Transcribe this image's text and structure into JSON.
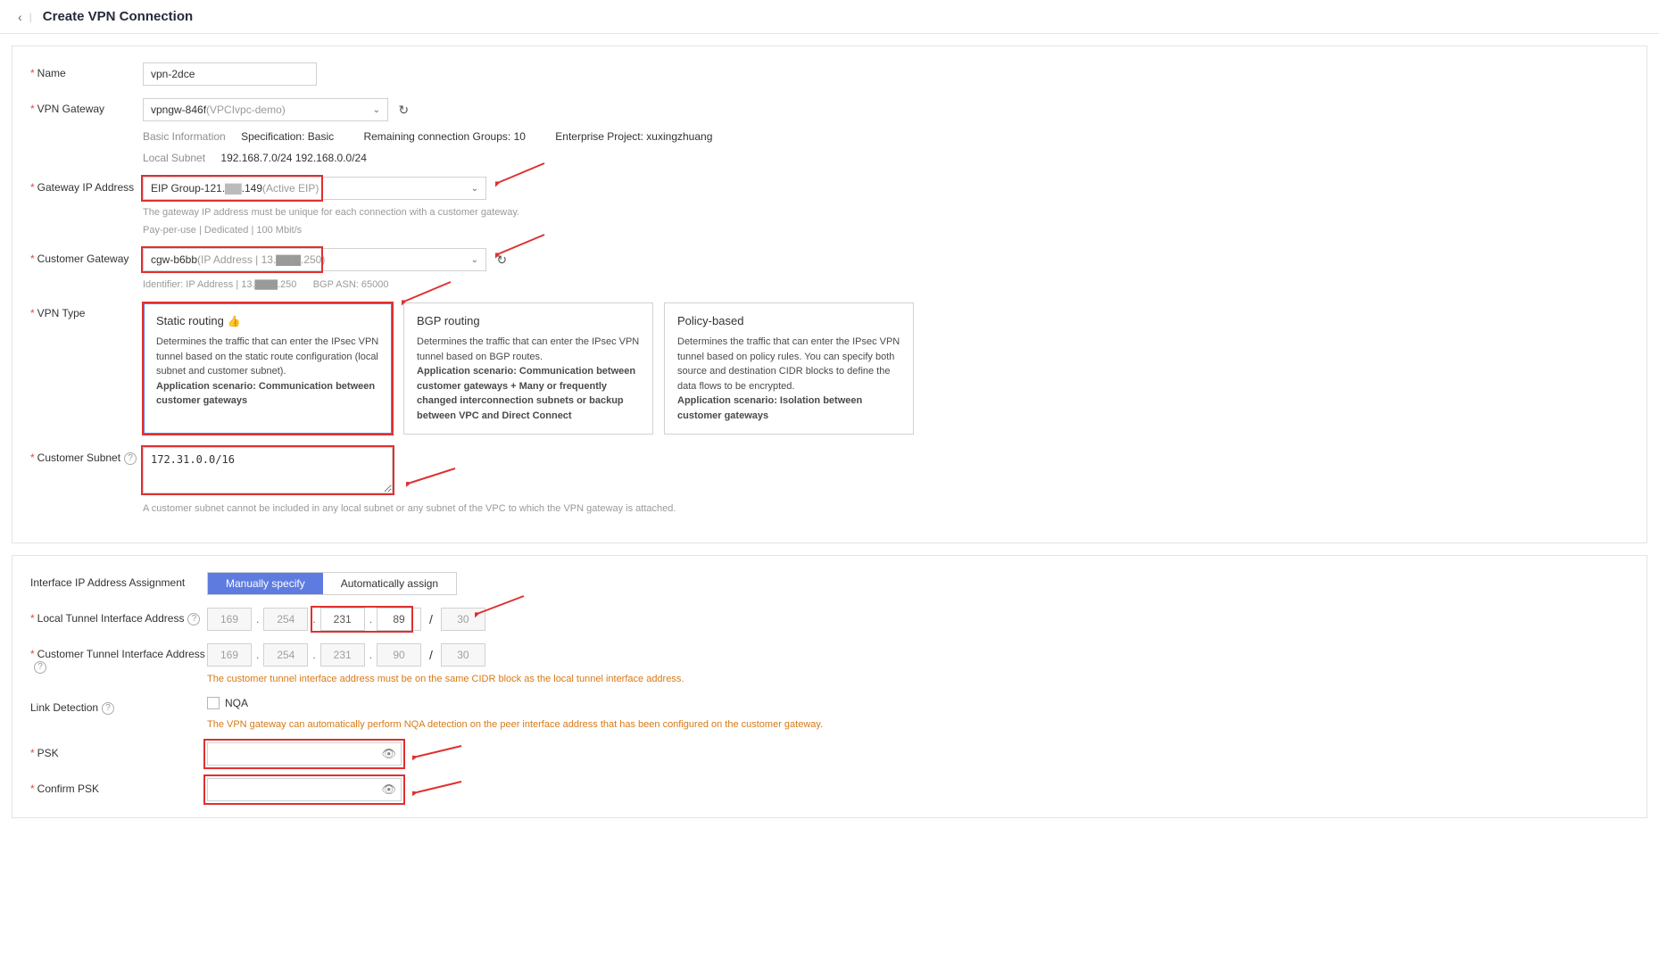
{
  "header": {
    "title": "Create VPN Connection"
  },
  "labels": {
    "name": "Name",
    "vpn_gateway": "VPN Gateway",
    "gateway_ip": "Gateway IP Address",
    "customer_gateway": "Customer Gateway",
    "vpn_type": "VPN Type",
    "customer_subnet": "Customer Subnet",
    "interface_assignment": "Interface IP Address Assignment",
    "local_tunnel": "Local Tunnel Interface Address",
    "customer_tunnel": "Customer Tunnel Interface Address",
    "link_detection": "Link Detection",
    "psk": "PSK",
    "confirm_psk": "Confirm PSK"
  },
  "name": "vpn-2dce",
  "vpn_gateway": {
    "selected": "vpngw-846f",
    "selected_suffix": "(VPCIvpc-demo)",
    "basic_info_label": "Basic Information",
    "spec": "Specification: Basic",
    "remaining": "Remaining connection Groups: 10",
    "enterprise_project": "Enterprise Project: xuxingzhuang",
    "local_subnet_label": "Local Subnet",
    "local_subnet": "192.168.7.0/24 192.168.0.0/24"
  },
  "gateway_ip": {
    "prefix": "EIP Group-121.",
    "masked": "▇▇",
    "suffix": ".149",
    "status": "(Active EIP)",
    "hint": "The gateway IP address must be unique for each connection with a customer gateway.",
    "billing": "Pay-per-use | Dedicated | 100 Mbit/s"
  },
  "customer_gateway": {
    "name": "cgw-b6bb",
    "detail": "(IP Address | 13.▇▇▇.250)",
    "identifier": "Identifier: IP Address | 13.▇▇▇.250",
    "bgp": "BGP ASN: 65000"
  },
  "vpn_types": [
    {
      "title": "Static routing",
      "recommended": true,
      "desc": "Determines the traffic that can enter the IPsec VPN tunnel based on the static route configuration (local subnet and customer subnet).",
      "scenario": "Application scenario: Communication between customer gateways"
    },
    {
      "title": "BGP routing",
      "recommended": false,
      "desc": "Determines the traffic that can enter the IPsec VPN tunnel based on BGP routes.",
      "scenario": "Application scenario: Communication between customer gateways + Many or frequently changed interconnection subnets or backup between VPC and Direct Connect"
    },
    {
      "title": "Policy-based",
      "recommended": false,
      "desc": "Determines the traffic that can enter the IPsec VPN tunnel based on policy rules. You can specify both source and destination CIDR blocks to define the data flows to be encrypted.",
      "scenario": "Application scenario: Isolation between customer gateways"
    }
  ],
  "customer_subnet": {
    "value": "172.31.0.0/16",
    "hint": "A customer subnet cannot be included in any local subnet or any subnet of the VPC to which the VPN gateway is attached."
  },
  "interface_assignment": {
    "manual": "Manually specify",
    "auto": "Automatically assign"
  },
  "local_tunnel": {
    "o1": "169",
    "o2": "254",
    "o3": "231",
    "o4": "89",
    "mask": "30"
  },
  "customer_tunnel": {
    "o1": "169",
    "o2": "254",
    "o3": "231",
    "o4": "90",
    "mask": "30",
    "warn": "The customer tunnel interface address must be on the same CIDR block as the local tunnel interface address."
  },
  "link_detection": {
    "nqa_label": "NQA",
    "note": "The VPN gateway can automatically perform NQA detection on the peer interface address that has been configured on the customer gateway."
  }
}
